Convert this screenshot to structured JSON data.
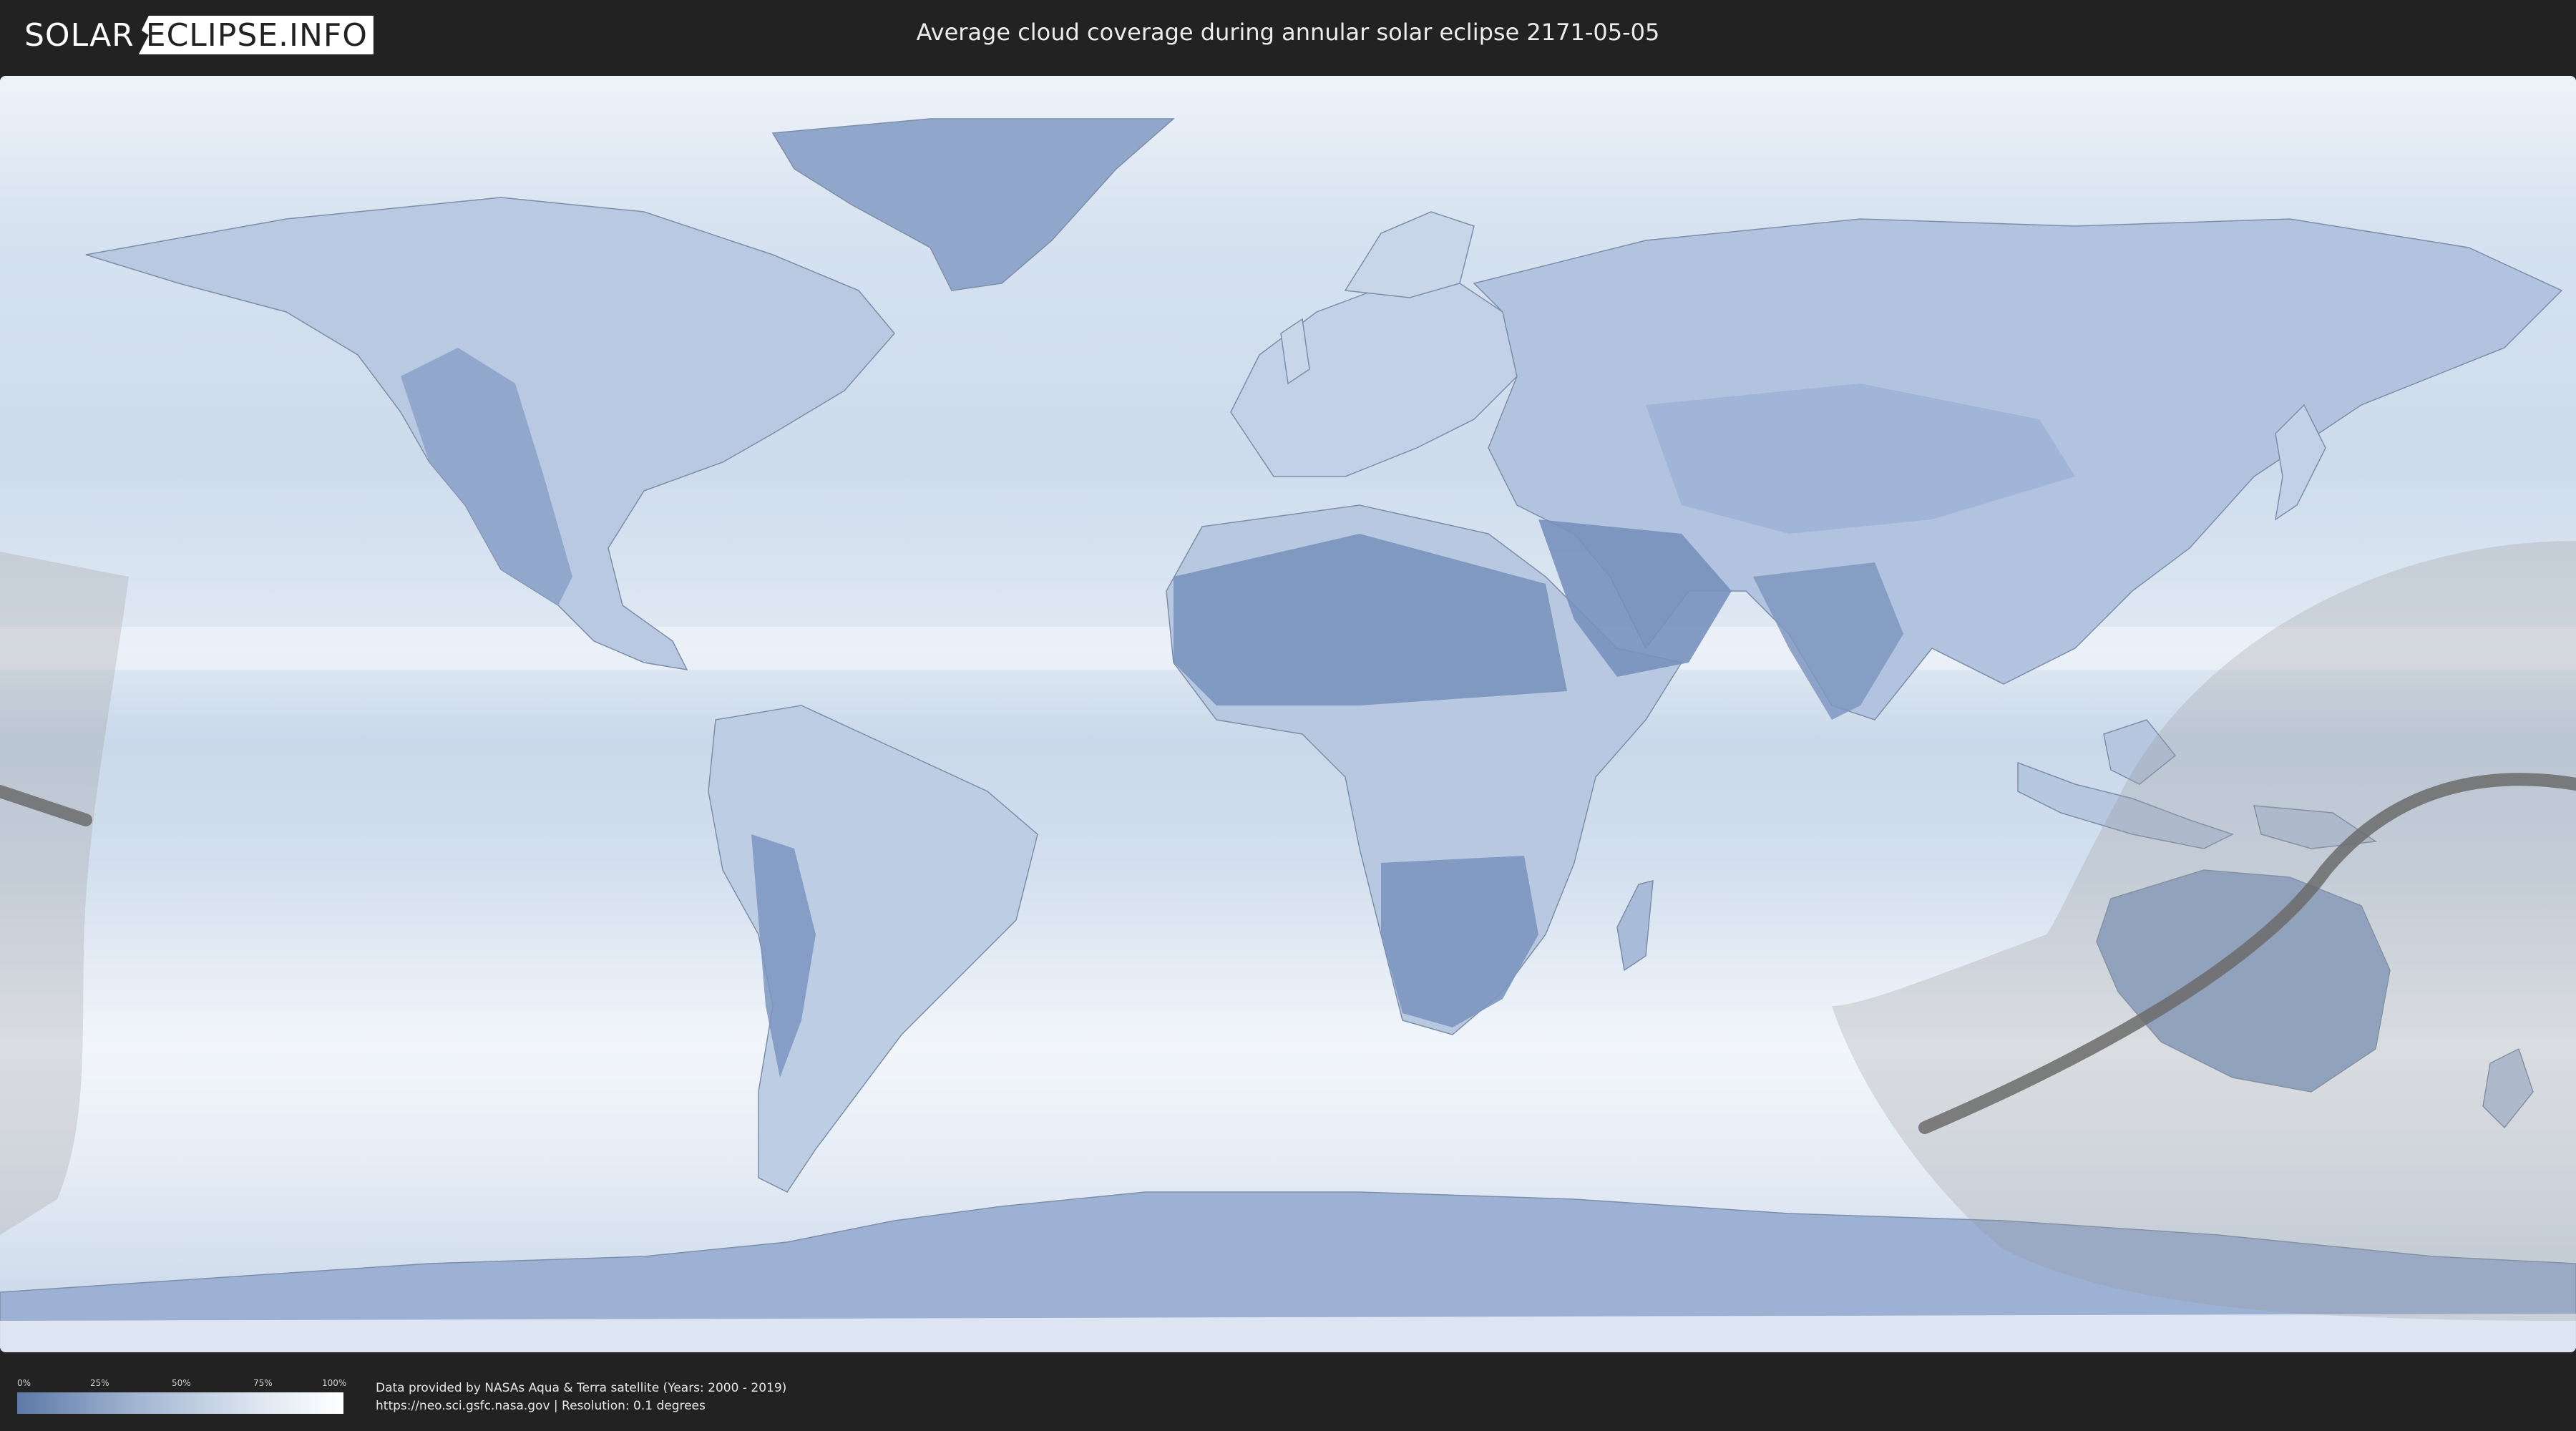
{
  "header": {
    "logo_left": "SOLAR",
    "logo_right": "ECLIPSE.INFO",
    "title": "Average cloud coverage during annular solar eclipse 2171-05-05"
  },
  "legend": {
    "ticks": [
      "0%",
      "25%",
      "50%",
      "75%",
      "100%"
    ],
    "gradient_colors": [
      "#5e79a8",
      "#9fb3d0",
      "#e0e8f2",
      "#ffffff"
    ]
  },
  "footer": {
    "credit_line1": "Data provided by NASAs Aqua & Terra satellite (Years: 2000 - 2019)",
    "credit_line2": "https://neo.sci.gsfc.nasa.gov | Resolution: 0.1 degrees"
  },
  "map": {
    "ocean_color": "#dbe6f2",
    "land_dark_color": "#7f97bf",
    "land_light_color": "#c7d5e8",
    "eclipse_zone_color": "#9a9a9a",
    "central_line_color": "#6b6b6b"
  }
}
